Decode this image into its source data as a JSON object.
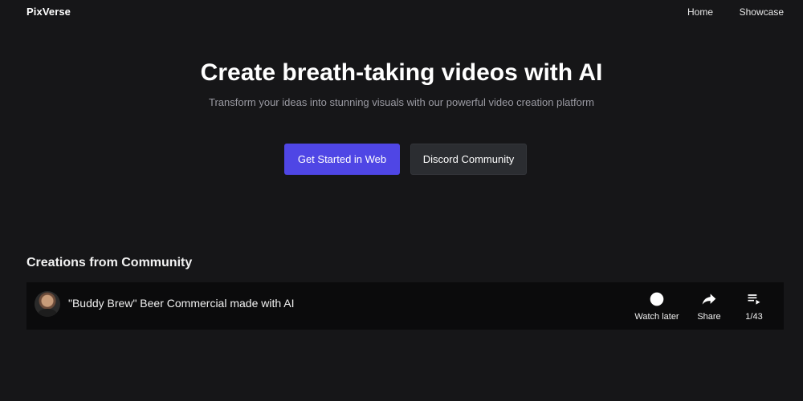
{
  "header": {
    "brand": "PixVerse",
    "nav": {
      "home": "Home",
      "showcase": "Showcase"
    }
  },
  "hero": {
    "title": "Create breath-taking videos with AI",
    "subtitle": "Transform your ideas into stunning visuals with our powerful video creation platform",
    "primary_button": "Get Started in Web",
    "secondary_button": "Discord Community"
  },
  "community": {
    "section_title": "Creations from Community",
    "video": {
      "title": "\"Buddy Brew\" Beer Commercial made with AI",
      "watch_later_label": "Watch later",
      "share_label": "Share",
      "playlist_position": "1/43"
    }
  },
  "colors": {
    "background": "#161618",
    "primary_button": "#4f46e5",
    "secondary_button": "#2b2d31",
    "video_bar": "#0b0b0c"
  },
  "icons": [
    "clock-icon",
    "share-arrow-icon",
    "playlist-icon"
  ]
}
